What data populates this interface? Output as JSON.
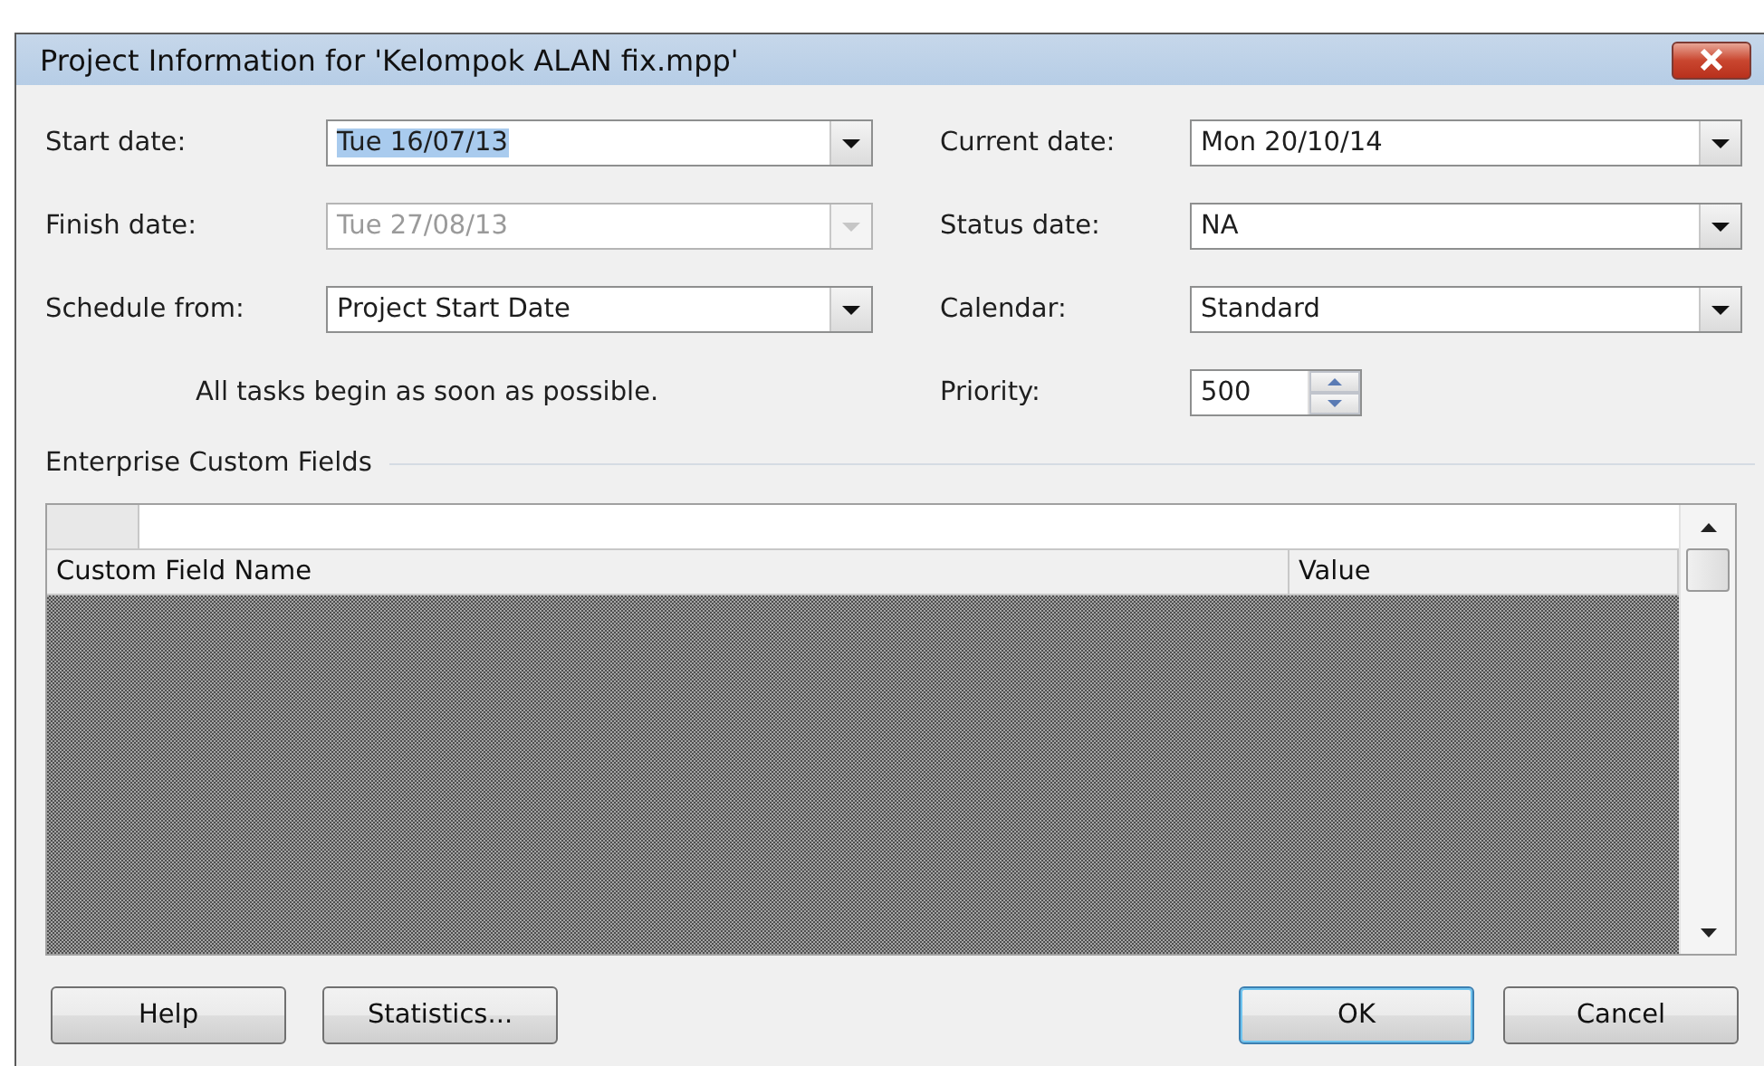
{
  "window": {
    "title": "Project Information for 'Kelompok ALAN fix.mpp'"
  },
  "left_fields": [
    {
      "label": "Start date:",
      "value": "Tue 16/07/13",
      "kind": "dropdown",
      "disabled": false,
      "highlighted": true
    },
    {
      "label": "Finish date:",
      "value": "Tue 27/08/13",
      "kind": "dropdown",
      "disabled": true,
      "highlighted": false
    },
    {
      "label": "Schedule from:",
      "value": "Project Start Date",
      "kind": "dropdown",
      "disabled": false,
      "highlighted": false
    }
  ],
  "schedule_note": "All tasks begin as soon as possible.",
  "right_fields": [
    {
      "label": "Current date:",
      "value": "Mon 20/10/14",
      "kind": "dropdown",
      "disabled": false,
      "highlighted": false
    },
    {
      "label": "Status date:",
      "value": "NA",
      "kind": "dropdown",
      "disabled": false,
      "highlighted": false
    },
    {
      "label": "Calendar:",
      "value": "Standard",
      "kind": "dropdown",
      "disabled": false,
      "highlighted": false
    },
    {
      "label": "Priority:",
      "value": "500",
      "kind": "spinner",
      "disabled": false,
      "highlighted": false
    }
  ],
  "group": {
    "title": "Enterprise Custom Fields"
  },
  "table": {
    "columns": [
      "Custom Field Name",
      "Value"
    ]
  },
  "buttons": [
    {
      "label": "Help",
      "default": false
    },
    {
      "label": "Statistics...",
      "default": false
    },
    {
      "label": "OK",
      "default": true
    },
    {
      "label": "Cancel",
      "default": false
    }
  ]
}
